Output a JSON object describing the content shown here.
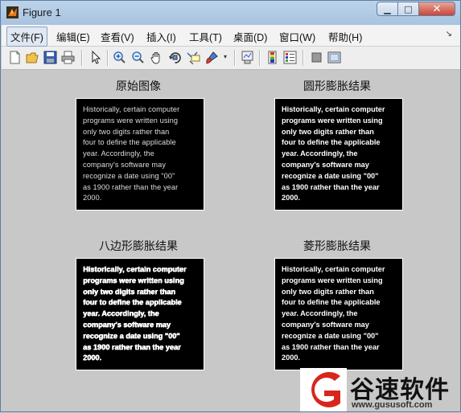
{
  "window": {
    "title": "Figure 1"
  },
  "menu": {
    "items": [
      "文件(F)",
      "编辑(E)",
      "查看(V)",
      "插入(I)",
      "工具(T)",
      "桌面(D)",
      "窗口(W)",
      "帮助(H)"
    ]
  },
  "toolbar": {
    "icons": [
      "new-figure-icon",
      "open-file-icon",
      "save-icon",
      "print-icon",
      "pointer-icon",
      "zoom-in-icon",
      "zoom-out-icon",
      "pan-icon",
      "rotate-3d-icon",
      "data-cursor-icon",
      "brush-icon",
      "link-plot-icon",
      "colorbar-icon",
      "legend-icon",
      "hide-plot-tools-icon",
      "show-plot-tools-icon"
    ]
  },
  "subplots": [
    {
      "title": "原始图像",
      "text": "Historically, certain computer\nprograms were written using\nonly two digits rather than\nfour to define the applicable\nyear. Accordingly, the\ncompany's software may\nrecognize a date using \"00\"\nas 1900 rather than the year\n2000."
    },
    {
      "title": "圆形膨胀结果",
      "text": "Historically, certain computer\nprograms were written using\nonly two digits rather than\nfour to define the applicable\nyear. Accordingly, the\ncompany's software may\nrecognize a date using \"00\"\nas 1900 rather than the year\n2000."
    },
    {
      "title": "八边形膨胀结果",
      "text": "Historically, certain computer\nprograms were written using\nonly two digits rather than\nfour to define the applicable\nyear. Accordingly, the\ncompany's software may\nrecognize a date using \"00\"\nas 1900 rather than the year\n2000."
    },
    {
      "title": "菱形膨胀结果",
      "text": "Historically, certain computer\nprograms were written using\nonly two digits rather than\nfour to define the applicable\nyear. Accordingly, the\ncompany's software may\nrecognize a date using \"00\"\nas 1900 rather than the year\n2000."
    }
  ],
  "watermark": {
    "brand": "谷速软件",
    "url": "www.gususoft.com"
  },
  "colors": {
    "titlebar": "#bcd3ea",
    "figure_bg": "#c8c8c8",
    "close_button": "#c8463a",
    "image_bg": "#000000"
  }
}
